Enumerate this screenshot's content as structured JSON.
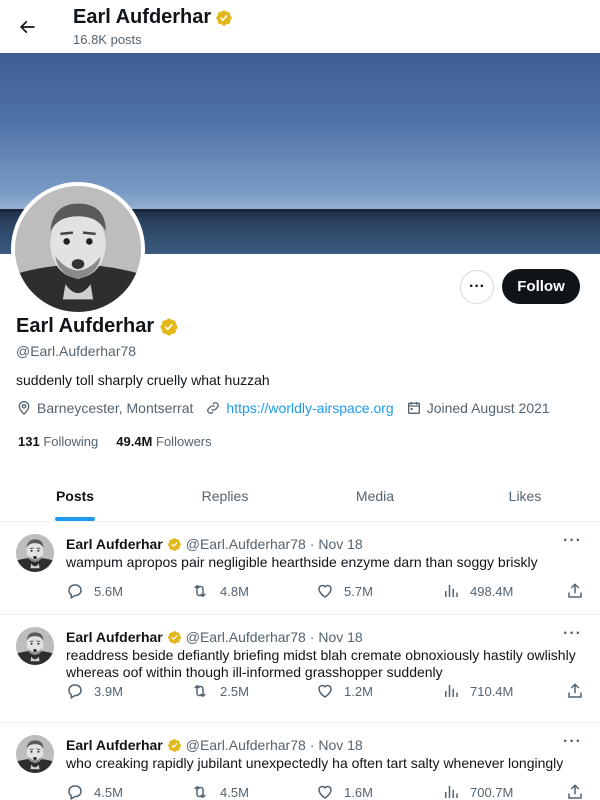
{
  "header": {
    "name": "Earl Aufderhar",
    "posts_count": "16.8K posts"
  },
  "profile": {
    "name": "Earl Aufderhar",
    "handle": "@Earl.Aufderhar78",
    "bio": "suddenly toll sharply cruelly what huzzah",
    "location": "Barneycester, Montserrat",
    "website": "https://worldly-airspace.org",
    "joined": "Joined August 2021",
    "following_count": "131",
    "following_label": "Following",
    "followers_count": "49.4M",
    "followers_label": "Followers",
    "follow_label": "Follow",
    "more_label": "···"
  },
  "tabs": [
    {
      "label": "Posts",
      "active": true
    },
    {
      "label": "Replies",
      "active": false
    },
    {
      "label": "Media",
      "active": false
    },
    {
      "label": "Likes",
      "active": false
    }
  ],
  "tweets": [
    {
      "name": "Earl Aufderhar",
      "handle": "@Earl.Aufderhar78",
      "date": "· Nov 18",
      "text": "wampum apropos pair negligible hearthside enzyme darn than soggy briskly",
      "replies": "5.6M",
      "reposts": "4.8M",
      "likes": "5.7M",
      "views": "498.4M"
    },
    {
      "name": "Earl Aufderhar",
      "handle": "@Earl.Aufderhar78",
      "date": "· Nov 18",
      "text": "readdress beside defiantly briefing midst blah cremate obnoxiously hastily owlishly whereas oof within though ill-informed grasshopper suddenly",
      "replies": "3.9M",
      "reposts": "2.5M",
      "likes": "1.2M",
      "views": "710.4M"
    },
    {
      "name": "Earl Aufderhar",
      "handle": "@Earl.Aufderhar78",
      "date": "· Nov 18",
      "text": "who creaking rapidly jubilant unexpectedly ha often tart salty whenever longingly",
      "replies": "4.5M",
      "reposts": "4.5M",
      "likes": "1.6M",
      "views": "700.7M"
    }
  ],
  "colors": {
    "accent": "#1d9bf0",
    "verified": "#e2b719",
    "text": "#0f1419",
    "muted": "#536471"
  }
}
